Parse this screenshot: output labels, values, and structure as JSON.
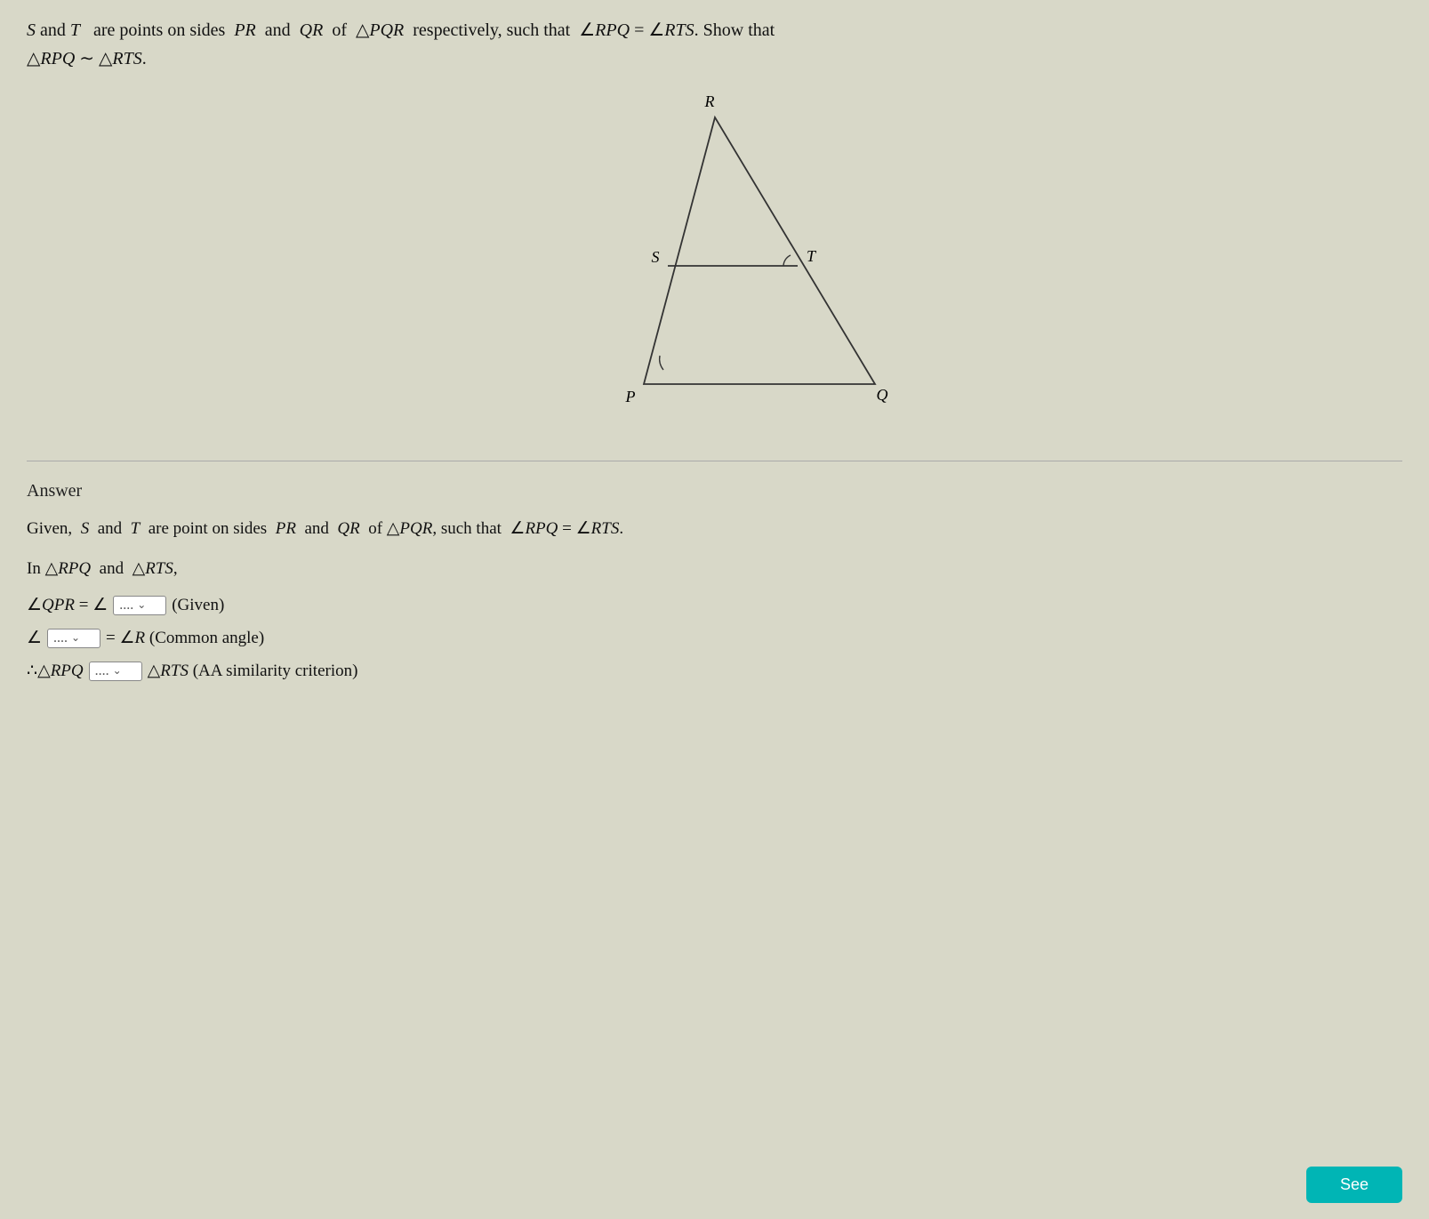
{
  "question": {
    "intro": "S and T  are points on sides  PR  and  QR  of △PQR  respectively, such that  ∠RPQ = ∠RTS. Show that",
    "conclusion": "△RPQ ∼ △RTS.",
    "diagram": {
      "vertex_R": "R",
      "vertex_P": "P",
      "vertex_Q": "Q",
      "vertex_S": "S",
      "vertex_T": "T"
    }
  },
  "answer": {
    "label": "Answer",
    "given_text": "Given,  S  and  T  are point on sides  PR  and  QR  of △PQR, such that  ∠RPQ = ∠RTS.",
    "in_triangles": "In △RPQ  and  △RTS,",
    "row1_prefix": "∠QPR = ∠",
    "row1_dropdown": "....",
    "row1_suffix": "(Given)",
    "row2_prefix": "∠",
    "row2_dropdown": "....",
    "row2_suffix": "= ∠R (Common angle)",
    "row3_prefix": "∴△RPQ",
    "row3_dropdown": "....",
    "row3_suffix": "△RTS (AA similarity criterion)",
    "see_button": "See"
  }
}
